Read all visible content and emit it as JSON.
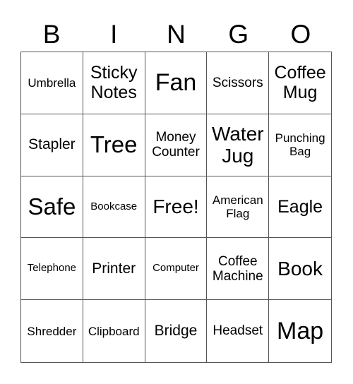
{
  "header": [
    "B",
    "I",
    "N",
    "G",
    "O"
  ],
  "cells": [
    "Umbrella",
    "Sticky Notes",
    "Fan",
    "Scissors",
    "Coffee Mug",
    "Stapler",
    "Tree",
    "Money Counter",
    "Water Jug",
    "Punching Bag",
    "Safe",
    "Bookcase",
    "Free!",
    "American Flag",
    "Eagle",
    "Telephone",
    "Printer",
    "Computer",
    "Coffee Machine",
    "Book",
    "Shredder",
    "Clipboard",
    "Bridge",
    "Headset",
    "Map"
  ]
}
